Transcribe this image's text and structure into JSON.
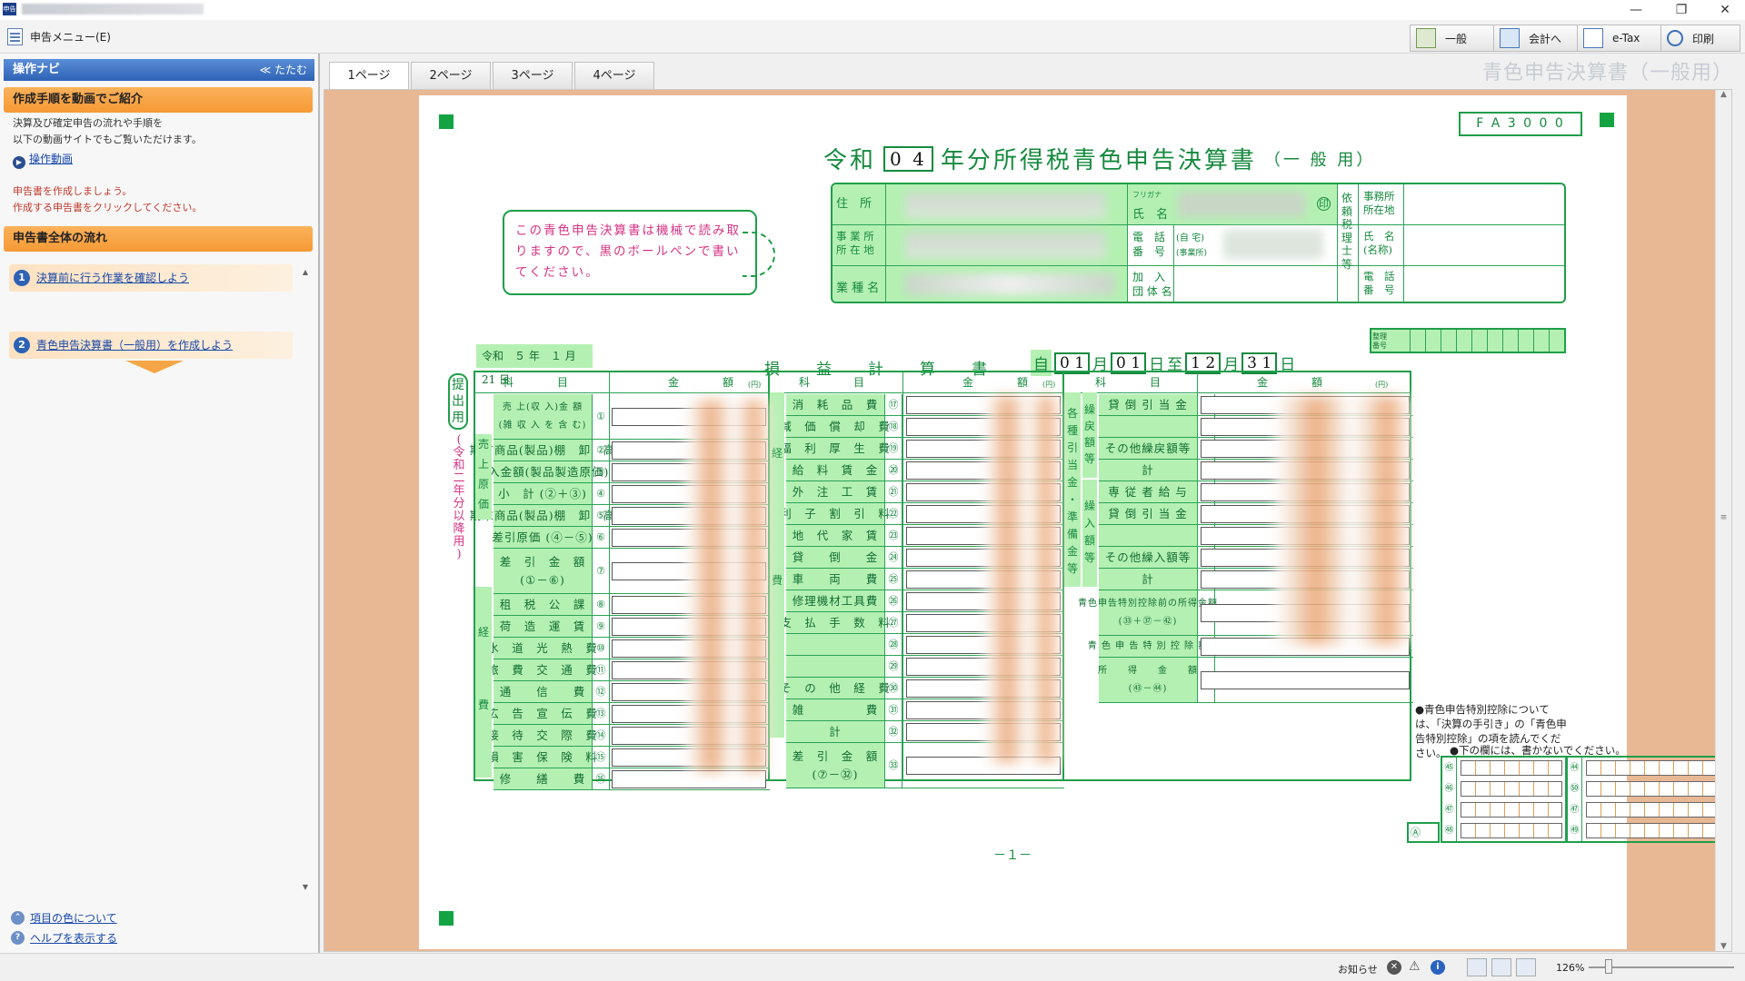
{
  "window": {
    "app_icon_text": "申告"
  },
  "menubar": {
    "menu_label": "申告メニュー(E)"
  },
  "toolbar": {
    "buttons": [
      {
        "label": "一般",
        "icon": "table-icon"
      },
      {
        "label": "会計へ",
        "icon": "export-icon"
      },
      {
        "label": "e-Tax",
        "icon": "etax-icon"
      },
      {
        "label": "印刷",
        "icon": "print-preview-icon"
      }
    ]
  },
  "nav": {
    "title": "操作ナビ",
    "collapse_label": "≪ たたむ",
    "section1": "作成手順を動画でご紹介",
    "intro_line1": "決算及び確定申告の流れや手順を",
    "intro_line2": "以下の動画サイトでもご覧いただけます。",
    "video_link": "操作動画",
    "prompt_line1": "申告書を作成しましょう。",
    "prompt_line2": "作成する申告書をクリックしてください。",
    "section2": "申告書全体の流れ",
    "step1_num": "1",
    "step1": "決算前に行う作業を確認しよう",
    "step2_num": "2",
    "step2": "青色申告決算書（一般用）を作成しよう",
    "help1": "項目の色について",
    "help2": "ヘルプを表示する"
  },
  "tabs": [
    "1ページ",
    "2ページ",
    "3ページ",
    "4ページ"
  ],
  "doc_title": "青色申告決算書（一般用）",
  "form": {
    "code": "F A 3 0 0 0",
    "title_prefix": "令和",
    "year_digits": "0 4",
    "title_main": "年分所得税青色申告決算書",
    "title_suffix": "（一 般 用）",
    "notice": "この青色申告決算書は機械で読み取りますので、黒のボールペンで書いてください。",
    "hdr_address": "住　所",
    "hdr_furigana": "フリガナ",
    "hdr_name": "氏　名",
    "hdr_seal": "印",
    "hdr_office": "事 業 所\n所 在 地",
    "hdr_phone": "電　話\n番　号",
    "hdr_phone_home": "(自 宅)",
    "hdr_phone_office": "(事業所)",
    "hdr_business": "業 種 名",
    "hdr_union": "加　入\n団 体 名",
    "hdr_agent": "依\n頼\n税\n理\n士\n等",
    "hdr_agent_office": "事務所\n所在地",
    "hdr_agent_name": "氏　名\n(名称)",
    "hdr_agent_phone": "電　話\n番　号",
    "date_label": "令和　５ 年　１ 月 21 日",
    "pl_title": "損　　益　　計　　算　　書",
    "period_from": "自",
    "m1": "0 1",
    "d1": "0 1",
    "m2": "1 2",
    "d2": "3 1",
    "month": "月",
    "day": "日",
    "to": "至",
    "seiri": "整理\n番号",
    "submit": "提\n出\n用",
    "era_note": "(\n令\n和\n二\n年\n分\n以\n降\n用\n)",
    "col_item": "科　　　目",
    "col_amount": "金　　　額",
    "yen": "(円)",
    "page_no": "－１－",
    "note_special": "●青色申告特別控除については、「決算の手引き」の「青色申告特別控除」の項を読んでください。",
    "note_blank": "●下の欄には、書かないでください。",
    "col1_rows": [
      {
        "no": "①",
        "label": "売 上(収 入)金 額\n(雑 収 入 を 含 む)"
      },
      {
        "no": "②",
        "label": "期首商品(製品)棚　卸　高"
      },
      {
        "no": "③",
        "label": "仕入金額(製品製造原価)"
      },
      {
        "no": "④",
        "label": "小　計 (②＋③)"
      },
      {
        "no": "⑤",
        "label": "期末商品(製品)棚　卸　高"
      },
      {
        "no": "⑥",
        "label": "差引原価 (④－⑤)"
      },
      {
        "no": "⑦",
        "label": "差　引　金　額\n(①－⑥)"
      },
      {
        "no": "⑧",
        "label": "租　税　公　課"
      },
      {
        "no": "⑨",
        "label": "荷　造　運　賃"
      },
      {
        "no": "⑩",
        "label": "水　道　光　熱　費"
      },
      {
        "no": "⑪",
        "label": "旅　費　交　通　費"
      },
      {
        "no": "⑫",
        "label": "通　　信　　費"
      },
      {
        "no": "⑬",
        "label": "広　告　宣　伝　費"
      },
      {
        "no": "⑭",
        "label": "接　待　交　際　費"
      },
      {
        "no": "⑮",
        "label": "損　害　保　険　料"
      },
      {
        "no": "⑯",
        "label": "修　　繕　　費"
      }
    ],
    "col1_side_cost": "売\n上\n原\n価",
    "col1_side_exp": "経\n\n\n\n費",
    "col2_rows": [
      {
        "no": "⑰",
        "label": "消　耗　品　費"
      },
      {
        "no": "⑱",
        "label": "減　価　償　却　費"
      },
      {
        "no": "⑲",
        "label": "福　利　厚　生　費"
      },
      {
        "no": "⑳",
        "label": "給　料　賃　金"
      },
      {
        "no": "㉑",
        "label": "外　注　工　賃"
      },
      {
        "no": "㉒",
        "label": "利　子　割　引　料"
      },
      {
        "no": "㉓",
        "label": "地　代　家　賃"
      },
      {
        "no": "㉔",
        "label": "貸　　倒　　金"
      },
      {
        "no": "㉕",
        "label": "車　　両　　費"
      },
      {
        "no": "㉖",
        "label": "修理機材工具費"
      },
      {
        "no": "㉗",
        "label": "支　払　手　数　料"
      },
      {
        "no": "㉘",
        "label": ""
      },
      {
        "no": "㉙",
        "label": ""
      },
      {
        "no": "㉚",
        "label": "そ　の　他　経　費"
      },
      {
        "no": "㉛",
        "label": "雑　　　　　費"
      },
      {
        "no": "㉜",
        "label": "計"
      },
      {
        "no": "㉝",
        "label": "差　引　金　額\n(⑦－㉜)"
      }
    ],
    "col2_side": "経\n\n\n\n\n\n\n\n\n\n費",
    "col3_rows": [
      {
        "no": "㉞",
        "label": "貸 倒 引 当 金"
      },
      {
        "no": "㉟",
        "label": ""
      },
      {
        "no": "㊱",
        "label": "その他繰戻額等"
      },
      {
        "no": "㊲",
        "label": "計"
      },
      {
        "no": "㊳",
        "label": "専 従 者 給 与"
      },
      {
        "no": "㊴",
        "label": "貸 倒 引 当 金"
      },
      {
        "no": "㊵",
        "label": ""
      },
      {
        "no": "㊶",
        "label": "その他繰入額等"
      },
      {
        "no": "㊷",
        "label": "計"
      },
      {
        "no": "㊸",
        "label": "青色申告特別控除前の所得金額\n(㉝＋㊲－㊷)"
      },
      {
        "no": "㊹",
        "label": "青 色 申 告 特 別 控 除 額"
      },
      {
        "no": "㊺",
        "label": "所　　得　　金　　額\n(㊸－㊹)"
      }
    ],
    "col3_side_main": "各\n種\n引\n当\n金\n・\n準\n備\n金\n等",
    "col3_side_back": "繰\n戻\n額\n等",
    "col3_side_in": "繰\n入\n額\n等",
    "blank_rows_left": [
      "㊺",
      "㊻",
      "㊼",
      "㊽"
    ],
    "blank_rows_right": [
      "㊹",
      "㊿",
      "㊼",
      "㊾"
    ],
    "blank_corner": "Ⓐ"
  },
  "status": {
    "notice": "お知らせ",
    "zoom": "126%"
  }
}
